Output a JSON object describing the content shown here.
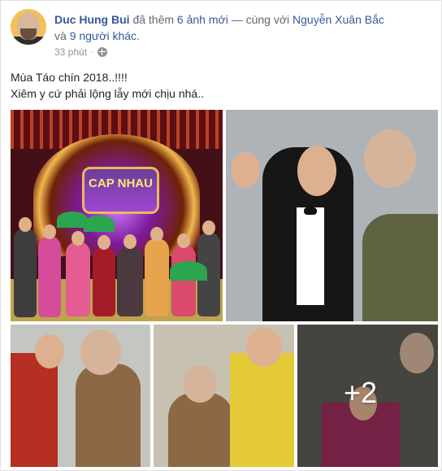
{
  "post": {
    "author": "Duc Hung Bui",
    "action": "đã thêm",
    "photo_count": "6 ảnh mới",
    "with_prefix": "— cùng với",
    "tagged_person": "Nguyễn Xuân Bắc",
    "and_text": "và",
    "others_text": "9 người khác",
    "timestamp": "33 phút",
    "caption_line_1": "Mùa Táo chín 2018..!!!!",
    "caption_line_2": "Xiêm y cứ phải lộng lẫy mới chịu nhá..",
    "more_photos_label": "+2"
  },
  "photos": [
    {
      "name": "stage-group-photo",
      "sign_text": "CAP NHAU"
    },
    {
      "name": "suit-adjusting-photo"
    },
    {
      "name": "costume-photo-1"
    },
    {
      "name": "costume-photo-2"
    },
    {
      "name": "costume-photo-3-more"
    }
  ],
  "icons": {
    "privacy": "globe-icon"
  },
  "colors": {
    "author": "#365899",
    "muted": "#90949c"
  }
}
